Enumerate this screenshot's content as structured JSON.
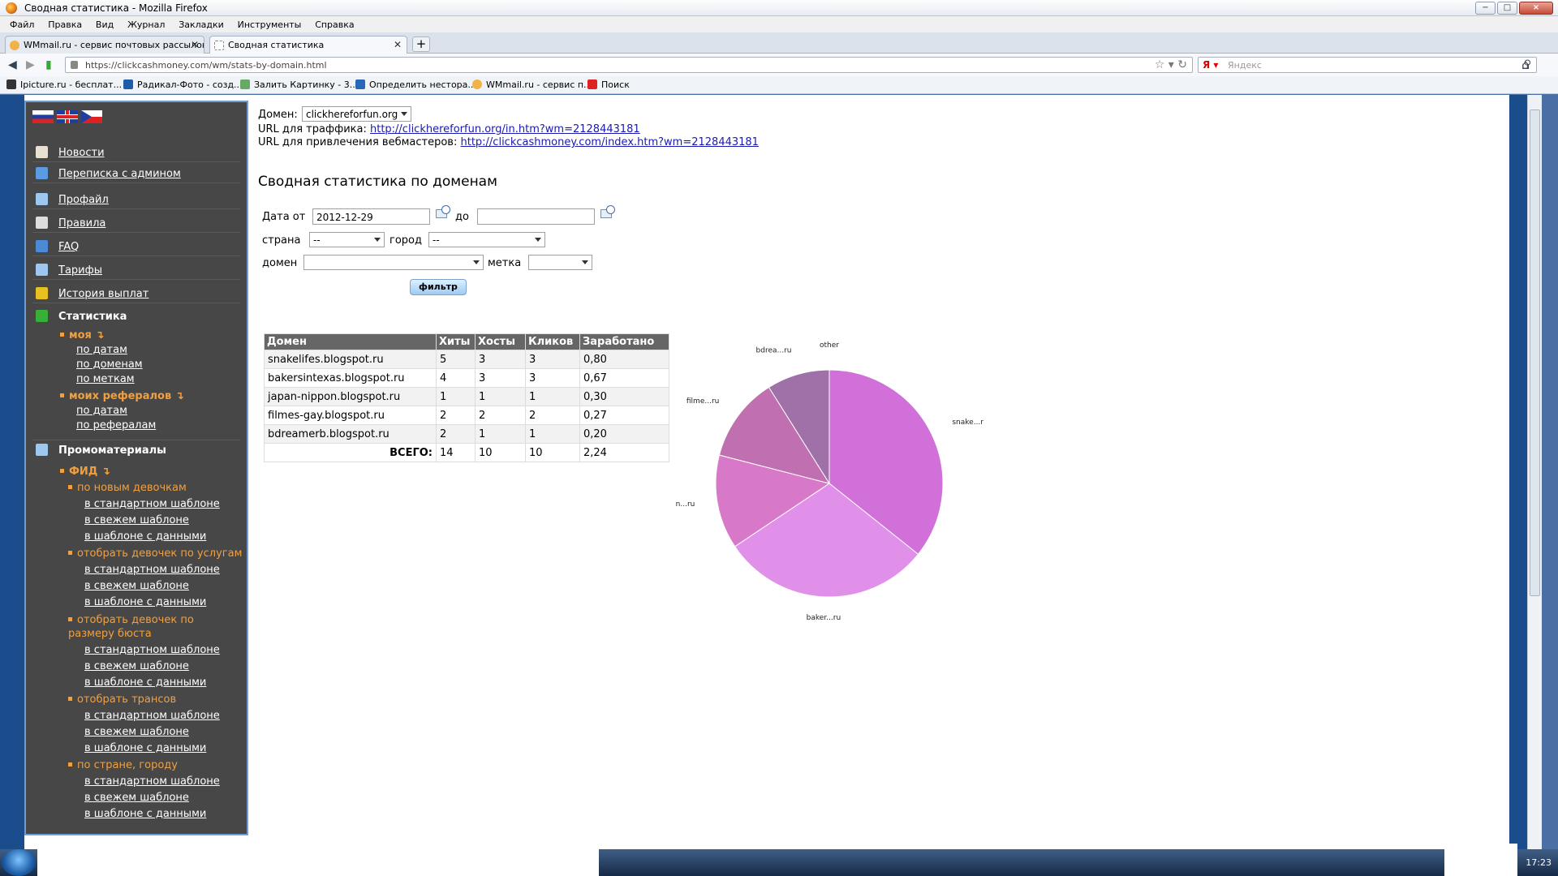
{
  "window": {
    "title": "Сводная статистика - Mozilla Firefox",
    "buttons": [
      "−",
      "□",
      "×"
    ]
  },
  "menu": [
    "Файл",
    "Правка",
    "Вид",
    "Журнал",
    "Закладки",
    "Инструменты",
    "Справка"
  ],
  "tabs": [
    {
      "label": "WMmail.ru - сервис почтовых рассылок..."
    },
    {
      "label": "Сводная статистика"
    }
  ],
  "address": {
    "url": "https://clickcashmoney.com/wm/stats-by-domain.html",
    "search_placeholder": "Яндекс"
  },
  "bookmarks": [
    "Ipicture.ru - бесплат...",
    "Радикал-Фото - созд...",
    "Залить Картинку - 3...",
    "Определить нестора...",
    "WMmail.ru - сервис п...",
    "Поиск"
  ],
  "sidebar": {
    "items": [
      {
        "label": "Новости",
        "color": "#e8e0d0"
      },
      {
        "label": "Переписка с админом",
        "color": "#5b9be0"
      },
      {
        "label": "Профайл",
        "color": "#9cc8f0"
      },
      {
        "label": "Правила",
        "color": "#ddd"
      },
      {
        "label": "FAQ",
        "color": "#4b8bd6"
      },
      {
        "label": "Тарифы",
        "color": "#9cc8f0"
      },
      {
        "label": "История выплат",
        "color": "#e8c020"
      },
      {
        "label": "Статистика",
        "color": "#38b038"
      }
    ],
    "stats_my": "моя",
    "stats_my_links": [
      "по датам",
      "по доменам",
      "по меткам"
    ],
    "stats_ref": "моих рефералов",
    "stats_ref_links": [
      "по датам",
      "по рефералам"
    ],
    "promo": "Промоматериалы",
    "feed": "ФИД",
    "feed_groups": [
      {
        "label": "по новым девочкам",
        "links": [
          "в стандартном шаблоне",
          "в свежем шаблоне",
          "в шаблоне с данными"
        ]
      },
      {
        "label": "отобрать девочек по услугам",
        "links": [
          "в стандартном шаблоне",
          "в свежем шаблоне",
          "в шаблоне с данными"
        ]
      },
      {
        "label": "отобрать девочек по размеру бюста",
        "links": [
          "в стандартном шаблоне",
          "в свежем шаблоне",
          "в шаблоне с данными"
        ]
      },
      {
        "label": "отобрать трансов",
        "links": [
          "в стандартном шаблоне",
          "в свежем шаблоне",
          "в шаблоне с данными"
        ]
      },
      {
        "label": "по стране, городу",
        "links": [
          "в стандартном шаблоне",
          "в свежем шаблоне",
          "в шаблоне с данными"
        ]
      }
    ]
  },
  "main": {
    "domain_label": "Домен:",
    "domain_value": "clickhereforfun.org",
    "traffic_label": "URL для траффика:",
    "traffic_url": "http://clickhereforfun.org/in.htm?wm=2128443181",
    "webmaster_label": "URL для привлечения вебмастеров:",
    "webmaster_url": "http://clickcashmoney.com/index.htm?wm=2128443181",
    "heading": "Сводная статистика по доменам",
    "filter": {
      "date_from_label": "Дата от",
      "date_from": "2012-12-29",
      "date_to_label": "до",
      "date_to": "",
      "country_label": "страна",
      "country_value": "--",
      "city_label": "город",
      "city_value": "--",
      "domain_label": "домен",
      "domain_value": "",
      "tag_label": "метка",
      "tag_value": "",
      "button": "фильтр"
    },
    "table": {
      "headers": [
        "Домен",
        "Хиты",
        "Хосты",
        "Кликов",
        "Заработано"
      ],
      "rows": [
        [
          "snakelifes.blogspot.ru",
          "5",
          "3",
          "3",
          "0,80"
        ],
        [
          "bakersintexas.blogspot.ru",
          "4",
          "3",
          "3",
          "0,67"
        ],
        [
          "japan-nippon.blogspot.ru",
          "1",
          "1",
          "1",
          "0,30"
        ],
        [
          "filmes-gay.blogspot.ru",
          "2",
          "2",
          "2",
          "0,27"
        ],
        [
          "bdreamerb.blogspot.ru",
          "2",
          "1",
          "1",
          "0,20"
        ]
      ],
      "total_label": "ВСЕГО:",
      "totals": [
        "14",
        "10",
        "10",
        "2,24"
      ]
    }
  },
  "chart_data": {
    "type": "pie",
    "categories": [
      "snake...ru",
      "baker...ru",
      "japan...ru",
      "filme...ru",
      "bdrea...ru",
      "other"
    ],
    "values": [
      0.8,
      0.67,
      0.3,
      0.27,
      0.2,
      0.0
    ],
    "colors": [
      "#d070d8",
      "#e090e8",
      "#d878c8",
      "#c070b0",
      "#a070a8",
      "#d83050"
    ]
  },
  "taskbar": {
    "clock": "17:23"
  }
}
